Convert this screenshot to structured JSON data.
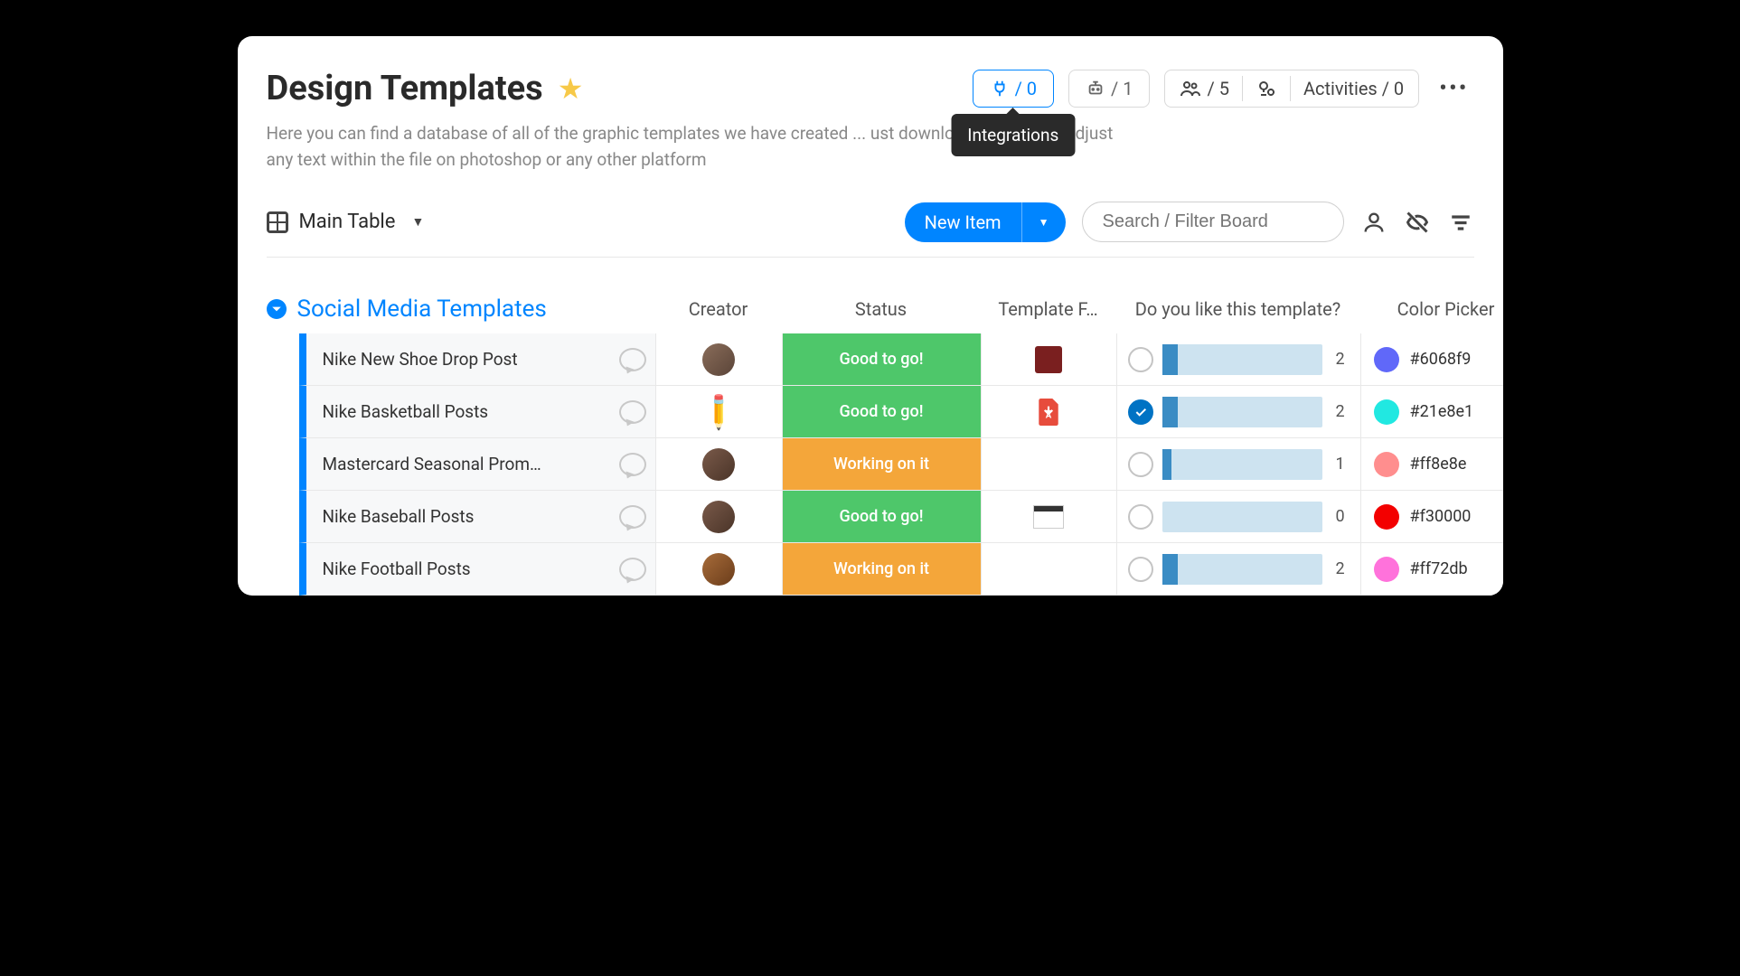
{
  "header": {
    "title": "Design Templates",
    "starred": true,
    "integrations_count": "/ 0",
    "automations_count": "/ 1",
    "members_count": "/ 5",
    "activities_label": "Activities / 0",
    "tooltip": "Integrations",
    "description": "Here you can find a database of all of the graphic templates we have created ... ust download the file and adjust any text within the file on photoshop or any other platform"
  },
  "toolbar": {
    "view_name": "Main Table",
    "new_item_label": "New Item",
    "search_placeholder": "Search / Filter Board"
  },
  "group": {
    "title": "Social Media Templates",
    "columns": {
      "creator": "Creator",
      "status": "Status",
      "file": "Template F…",
      "vote": "Do you like this template?",
      "color": "Color Picker"
    }
  },
  "rows": [
    {
      "name": "Nike New Shoe Drop Post",
      "creator_type": "avatar-m1",
      "status": "Good to go!",
      "status_kind": "good",
      "file_kind": "image",
      "vote_checked": false,
      "vote_fill_pct": 10,
      "vote_count": "2",
      "color_hex": "#6068f9"
    },
    {
      "name": "Nike Basketball Posts",
      "creator_type": "pencil",
      "status": "Good to go!",
      "status_kind": "good",
      "file_kind": "pdf",
      "vote_checked": true,
      "vote_fill_pct": 10,
      "vote_count": "2",
      "color_hex": "#21e8e1"
    },
    {
      "name": "Mastercard Seasonal Prom…",
      "creator_type": "avatar-f1",
      "status": "Working on it",
      "status_kind": "working",
      "file_kind": "none",
      "vote_checked": false,
      "vote_fill_pct": 6,
      "vote_count": "1",
      "color_hex": "#ff8e8e"
    },
    {
      "name": "Nike Baseball Posts",
      "creator_type": "avatar-f1",
      "status": "Good to go!",
      "status_kind": "good",
      "file_kind": "doc",
      "vote_checked": false,
      "vote_fill_pct": 0,
      "vote_count": "0",
      "color_hex": "#f30000"
    },
    {
      "name": "Nike Football Posts",
      "creator_type": "avatar-f2",
      "status": "Working on it",
      "status_kind": "working",
      "file_kind": "none",
      "vote_checked": false,
      "vote_fill_pct": 10,
      "vote_count": "2",
      "color_hex": "#ff72db"
    }
  ]
}
